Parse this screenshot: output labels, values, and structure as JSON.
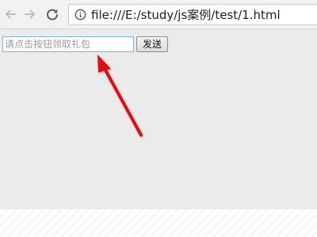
{
  "browser": {
    "url": "file:///E:/study/js案例/test/1.html",
    "back_icon": "back-arrow-icon",
    "forward_icon": "forward-arrow-icon",
    "reload_icon": "reload-icon",
    "info_icon": "info-icon"
  },
  "page": {
    "gift_input": {
      "placeholder": "请点击按钮领取礼包",
      "value": ""
    },
    "send_button_label": "发送",
    "annotation": {
      "type": "arrow",
      "color": "#e01010",
      "points_to": "gift-input"
    }
  }
}
